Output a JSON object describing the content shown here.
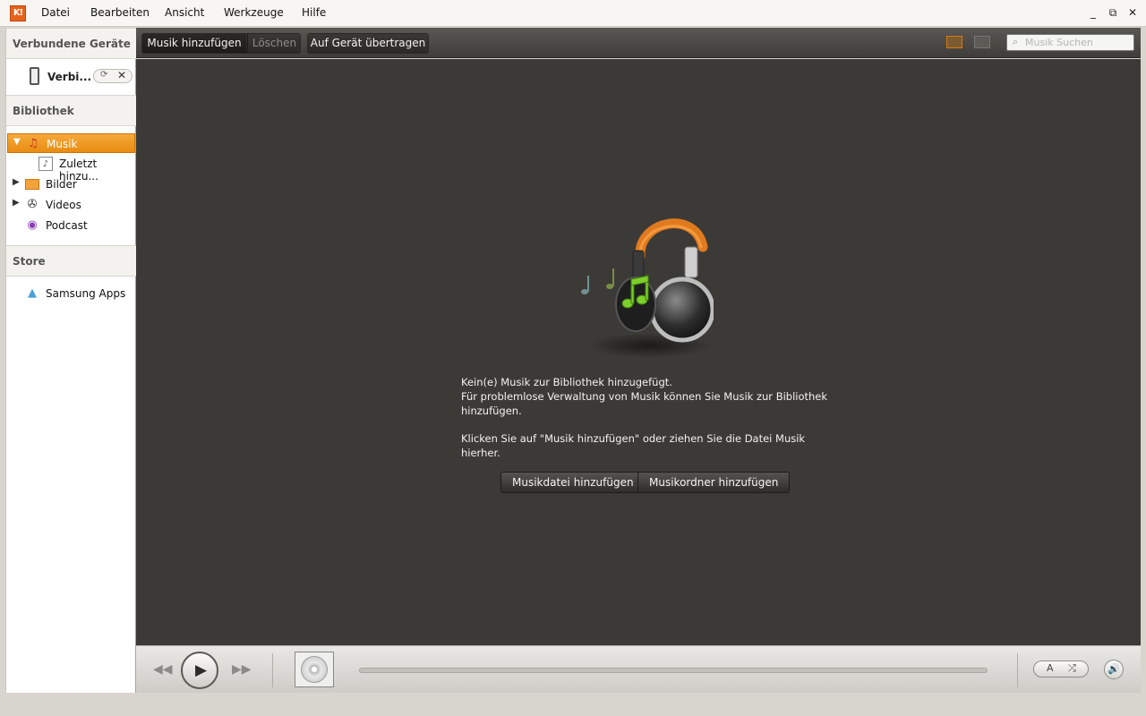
{
  "menubar": {
    "logo_text": "K!",
    "items": [
      "Datei",
      "Bearbeiten",
      "Ansicht",
      "Werkzeuge",
      "Hilfe"
    ],
    "window_controls": {
      "minimize": "_",
      "restore": "⧉",
      "close": "✕"
    }
  },
  "sidebar": {
    "connected_title": "Verbundene Geräte",
    "device": {
      "label": "Verbi...",
      "sync_icon": "sync-icon",
      "close": "✕"
    },
    "library_title": "Bibliothek",
    "items": [
      {
        "label": "Musik",
        "icon": "music-icon",
        "selected": true,
        "expanded": true
      },
      {
        "label": "Zuletzt hinzu...",
        "icon": "music-file-icon",
        "child": true
      },
      {
        "label": "Bilder",
        "icon": "pictures-icon"
      },
      {
        "label": "Videos",
        "icon": "film-reel-icon"
      },
      {
        "label": "Podcast",
        "icon": "podcast-icon"
      }
    ],
    "store_title": "Store",
    "store_item": {
      "label": "Samsung Apps",
      "icon": "samsung-apps-icon"
    }
  },
  "toolbar": {
    "add_music": "Musik hinzufügen",
    "delete": "Löschen",
    "transfer": "Auf Gerät übertragen",
    "search_placeholder": "Musik Suchen"
  },
  "content": {
    "line1": "Kein(e) Musik zur Bibliothek hinzugefügt.",
    "line2": "Für problemlose Verwaltung von Musik können Sie Musik zur Bibliothek hinzufügen.",
    "line3": "Klicken Sie auf \"Musik hinzufügen\" oder ziehen Sie die Datei Musik hierher.",
    "add_file_button": "Musikdatei hinzufügen",
    "add_folder_button": "Musikordner hinzufügen"
  },
  "player": {
    "prev": "◀◀",
    "play": "▶",
    "next": "▶▶",
    "repeat": "A",
    "shuffle": "⤮",
    "volume": "🔊",
    "progress": 0
  },
  "colors": {
    "accent_orange": "#e88c12",
    "content_bg": "#3c3a37",
    "headphone_band": "#e07a1f",
    "note_green": "#7ccf2a"
  }
}
